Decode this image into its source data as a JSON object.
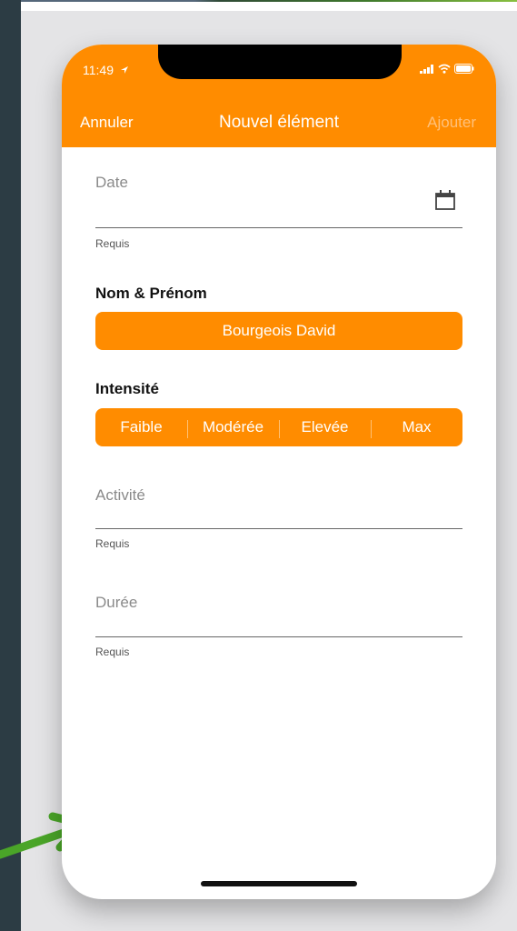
{
  "status_bar": {
    "time": "11:49"
  },
  "nav": {
    "cancel_label": "Annuler",
    "title": "Nouvel élément",
    "add_label": "Ajouter"
  },
  "form": {
    "date": {
      "label": "Date",
      "hint": "Requis",
      "icon": "calendar-icon"
    },
    "name_section": {
      "title": "Nom & Prénom",
      "value": "Bourgeois David"
    },
    "intensity_section": {
      "title": "Intensité",
      "options": [
        "Faible",
        "Modérée",
        "Elevée",
        "Max"
      ]
    },
    "activity": {
      "label": "Activité",
      "hint": "Requis"
    },
    "duration": {
      "label": "Durée",
      "hint": "Requis"
    }
  },
  "colors": {
    "accent": "#ff8c00",
    "add_disabled": "#ffc07a",
    "annotation_arrow": "#4aa528"
  }
}
